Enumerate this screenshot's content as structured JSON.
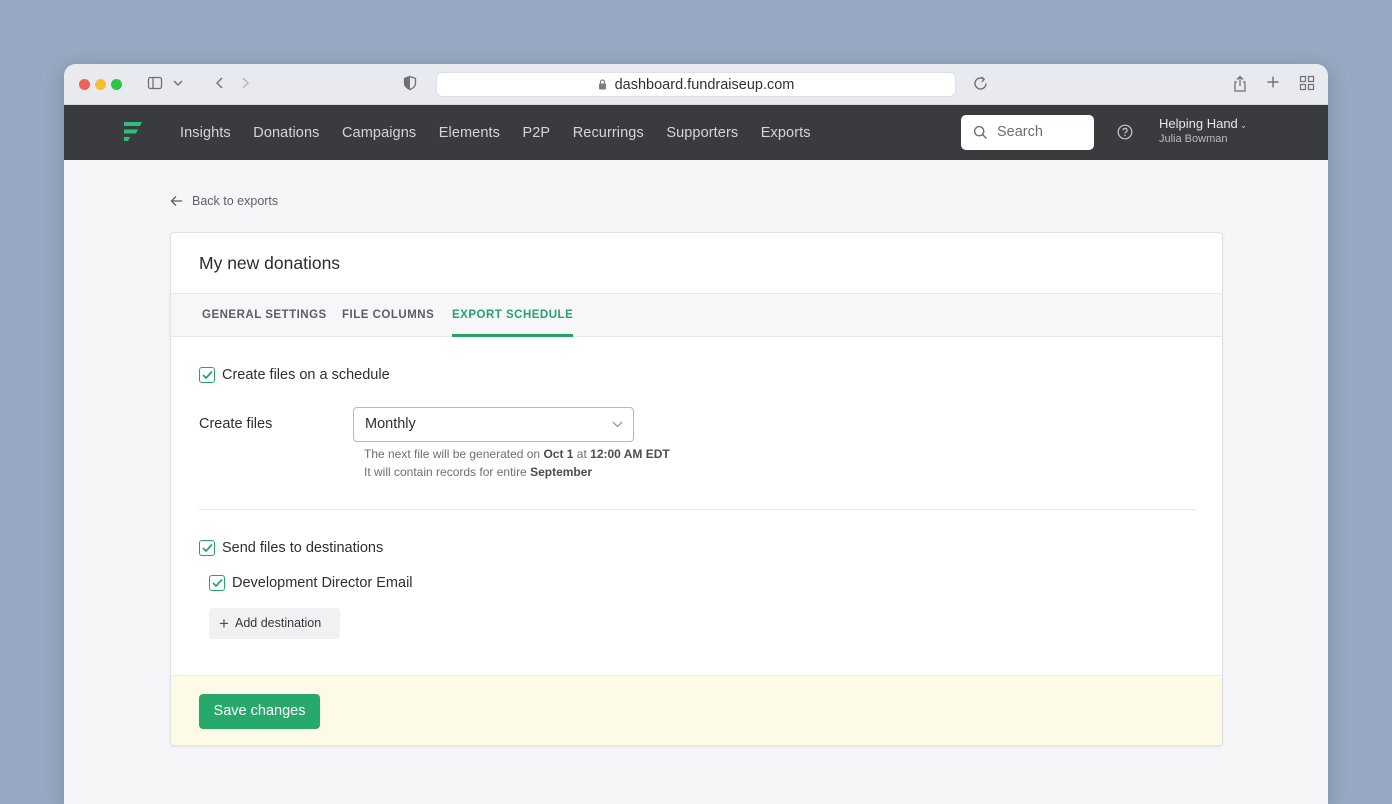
{
  "browser": {
    "url": "dashboard.fundraiseup.com"
  },
  "header": {
    "nav": [
      "Insights",
      "Donations",
      "Campaigns",
      "Elements",
      "P2P",
      "Recurrings",
      "Supporters",
      "Exports"
    ],
    "search_placeholder": "Search",
    "org_name": "Helping Hand",
    "user_name": "Julia Bowman"
  },
  "page": {
    "back_link": "Back to exports",
    "title": "My new donations",
    "tabs": [
      "GENERAL SETTINGS",
      "FILE COLUMNS",
      "EXPORT SCHEDULE"
    ],
    "active_tab": "EXPORT SCHEDULE"
  },
  "schedule": {
    "schedule_checkbox_label": "Create files on a schedule",
    "schedule_checked": true,
    "create_files_label": "Create files",
    "frequency": "Monthly",
    "hint1_prefix": "The next file will be generated on ",
    "hint1_date": "Oct 1",
    "hint1_mid": " at ",
    "hint1_time": "12:00 AM EDT",
    "hint2_prefix": "It will contain records for entire ",
    "hint2_period": "September"
  },
  "destinations": {
    "send_checkbox_label": "Send files to destinations",
    "send_checked": true,
    "items": [
      {
        "label": "Development Director Email",
        "checked": true
      }
    ],
    "add_label": "Add destination"
  },
  "footer": {
    "save_label": "Save changes"
  },
  "colors": {
    "accent": "#27a36a",
    "appbar": "#3a3b3f",
    "footer_bg": "#fdfbe8"
  }
}
